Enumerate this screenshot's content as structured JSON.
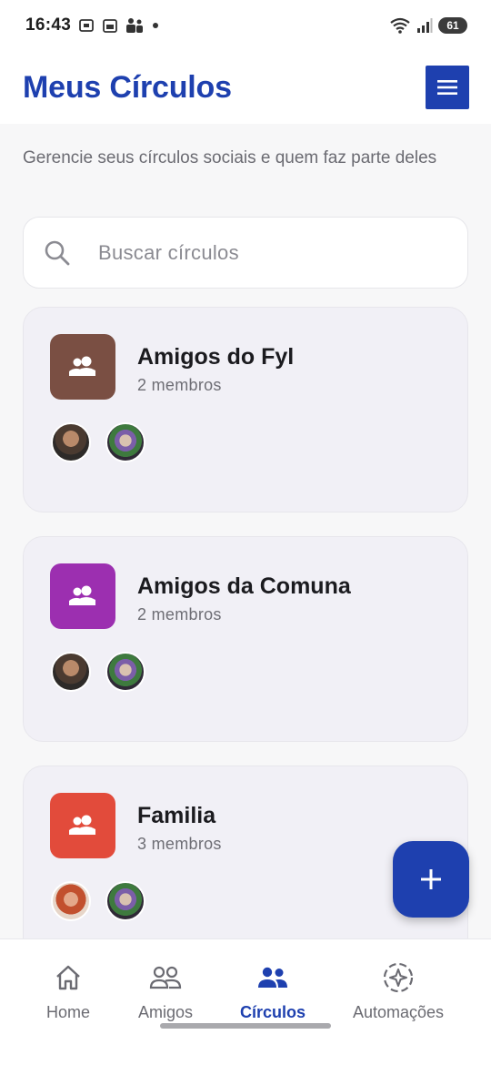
{
  "status_bar": {
    "time": "16:43",
    "battery": "61"
  },
  "header": {
    "title": "Meus Círculos"
  },
  "subtitle": "Gerencie seus círculos sociais e quem faz parte deles",
  "search": {
    "placeholder": "Buscar círculos"
  },
  "circles": [
    {
      "name": "Amigos do Fyl",
      "members": "2 membros",
      "color": "#7a4f43"
    },
    {
      "name": "Amigos da Comuna",
      "members": "2 membros",
      "color": "#9c2fb0"
    },
    {
      "name": "Familia",
      "members": "3 membros",
      "color": "#e24b3b"
    }
  ],
  "colors": {
    "accent": "#1e40af"
  },
  "bottom_nav": {
    "items": [
      {
        "label": "Home",
        "icon": "home-icon"
      },
      {
        "label": "Amigos",
        "icon": "people-outline-icon"
      },
      {
        "label": "Círculos",
        "icon": "group-icon",
        "active": true
      },
      {
        "label": "Automações",
        "icon": "auto-awesome-icon"
      }
    ]
  }
}
